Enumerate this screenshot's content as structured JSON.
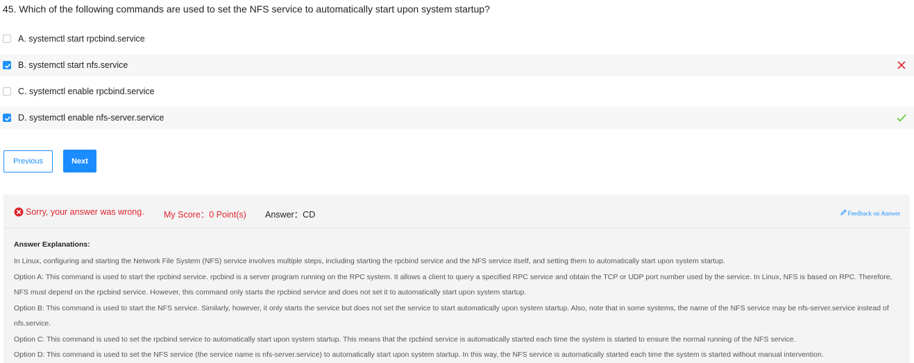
{
  "question": {
    "text": "45. Which of the following commands are used to set the NFS service to automatically start upon system startup?"
  },
  "options": [
    {
      "label": "A. systemctl start rpcbind.service",
      "checked": false,
      "mark": "none"
    },
    {
      "label": "B. systemctl start nfs.service",
      "checked": true,
      "mark": "wrong"
    },
    {
      "label": "C. systemctl enable rpcbind.service",
      "checked": false,
      "mark": "none"
    },
    {
      "label": "D. systemctl enable nfs-server.service",
      "checked": true,
      "mark": "correct"
    }
  ],
  "nav": {
    "previous_label": "Previous",
    "next_label": "Next"
  },
  "result": {
    "status_text": "Sorry, your answer was wrong.",
    "score_text": "My Score：0 Point(s)",
    "answer_text": "Answer：CD",
    "feedback_text": "Feedback on Answer"
  },
  "explanation": {
    "title": "Answer Explanations:",
    "paragraphs": [
      "In Linux, configuring and starting the Network File System (NFS) service involves multiple steps, including starting the rpcbind service and the NFS service itself, and setting them to automatically start upon system startup.",
      "Option A: This command is used to start the rpcbind service. rpcbind is a server program running on the RPC system. It allows a client to query a specified RPC service and obtain the TCP or UDP port number used by the service. In Linux, NFS is based on RPC. Therefore, NFS must depend on the rpcbind service. However, this command only starts the rpcbind service and does not set it to automatically start upon system startup.",
      "Option B: This command is used to start the NFS service. Similarly, however, it only starts the service but does not set the service to start automatically upon system startup. Also, note that in some systems, the name of the NFS service may be nfs-server.service instead of nfs.service.",
      "Option C: This command is used to set the rpcbind service to automatically start upon system startup. This means that the rpcbind service is automatically started each time the system is started to ensure the normal running of the NFS service.",
      "Option D: This command is used to set the NFS service (the service name is nfs-server.service) to automatically start upon system startup. In this way, the NFS service is automatically started each time the system is started without manual intervention."
    ]
  },
  "colors": {
    "accent": "#1a8cff",
    "error": "#e0252d",
    "correct": "#52c41a"
  },
  "icons": {
    "wrong_mark": "close-icon",
    "correct_mark": "check-icon",
    "error_status": "error-circle-icon",
    "feedback": "edit-icon"
  }
}
